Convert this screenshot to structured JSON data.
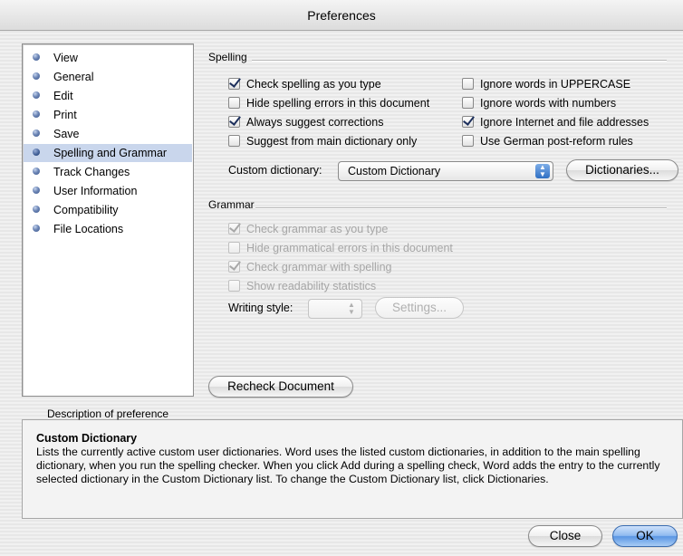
{
  "window": {
    "title": "Preferences"
  },
  "sidebar": {
    "items": [
      {
        "label": "View",
        "selected": false
      },
      {
        "label": "General",
        "selected": false
      },
      {
        "label": "Edit",
        "selected": false
      },
      {
        "label": "Print",
        "selected": false
      },
      {
        "label": "Save",
        "selected": false
      },
      {
        "label": "Spelling and Grammar",
        "selected": true
      },
      {
        "label": "Track Changes",
        "selected": false
      },
      {
        "label": "User Information",
        "selected": false
      },
      {
        "label": "Compatibility",
        "selected": false
      },
      {
        "label": "File Locations",
        "selected": false
      }
    ]
  },
  "spelling": {
    "title": "Spelling",
    "options": [
      {
        "label": "Check spelling as you type",
        "checked": true
      },
      {
        "label": "Hide spelling errors in this document",
        "checked": false
      },
      {
        "label": "Always suggest corrections",
        "checked": true
      },
      {
        "label": "Suggest from main dictionary only",
        "checked": false
      },
      {
        "label": "Ignore words in UPPERCASE",
        "checked": false
      },
      {
        "label": "Ignore words with numbers",
        "checked": false
      },
      {
        "label": "Ignore Internet and file addresses",
        "checked": true
      },
      {
        "label": "Use German post-reform rules",
        "checked": false
      }
    ],
    "custom_dictionary_label": "Custom dictionary:",
    "custom_dictionary_value": "Custom Dictionary",
    "dictionaries_button": "Dictionaries..."
  },
  "grammar": {
    "title": "Grammar",
    "options": [
      {
        "label": "Check grammar as you type",
        "checked": true
      },
      {
        "label": "Hide grammatical errors in this document",
        "checked": false
      },
      {
        "label": "Check grammar with spelling",
        "checked": true
      },
      {
        "label": "Show readability statistics",
        "checked": false
      }
    ],
    "writing_style_label": "Writing style:",
    "writing_style_value": "",
    "settings_button": "Settings..."
  },
  "recheck_button": "Recheck Document",
  "description": {
    "legend": "Description of preference",
    "heading": "Custom Dictionary",
    "body": "Lists the currently active custom user dictionaries. Word uses the listed custom dictionaries, in addition to the main spelling dictionary, when you run the spelling checker. When you click Add during a spelling check, Word adds the entry to the currently selected dictionary in the Custom Dictionary list. To change the Custom Dictionary list, click Dictionaries."
  },
  "footer": {
    "close_button": "Close",
    "ok_button": "OK"
  },
  "icons": {
    "sidebar_bullet": "bullet-icon",
    "popup_arrows": "updown-arrows-icon",
    "checkmark": "checkmark-icon"
  },
  "colors": {
    "selection": "#c9d6ec",
    "default_button": "#5a95e3",
    "checkmark": "#1c2f5c"
  }
}
